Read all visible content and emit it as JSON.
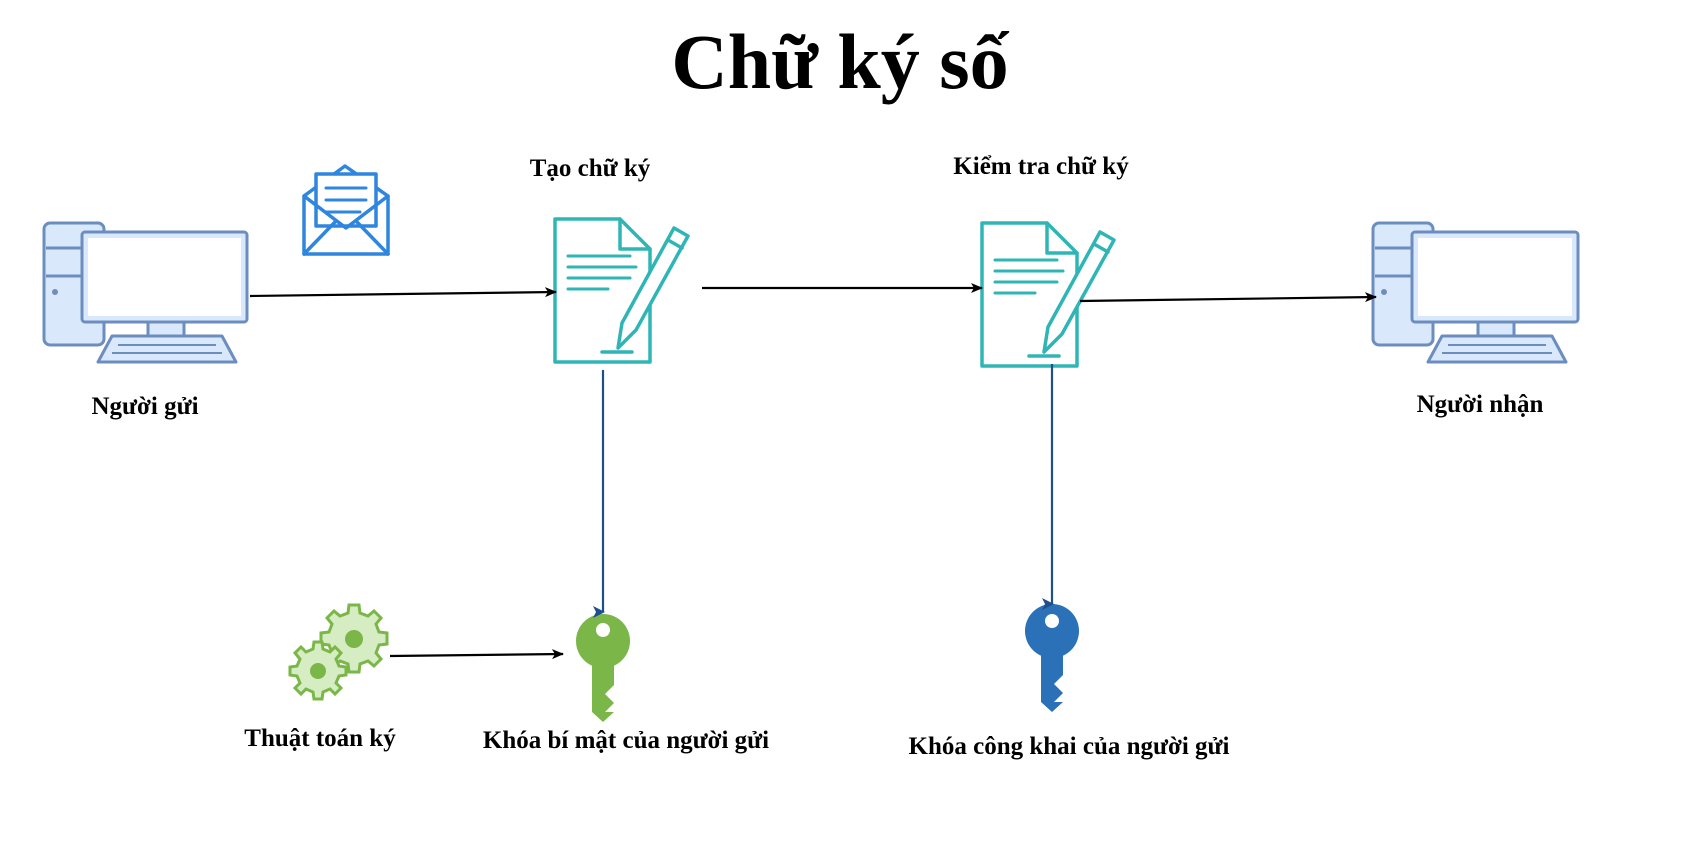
{
  "title": "Chữ ký số",
  "nodes": {
    "sender": {
      "label": "Người gửi",
      "icon": "computer-icon"
    },
    "receiver": {
      "label": "Người nhận",
      "icon": "computer-icon"
    },
    "create_signature": {
      "label": "Tạo chữ ký",
      "icon": "document-pen-icon"
    },
    "verify_signature": {
      "label": "Kiểm tra chữ ký",
      "icon": "document-pen-icon"
    },
    "message": {
      "icon": "envelope-icon"
    },
    "sign_algorithm": {
      "label": "Thuật toán ký",
      "icon": "gears-icon"
    },
    "private_key": {
      "label": "Khóa bí mật của người gửi",
      "icon": "key-icon"
    },
    "public_key": {
      "label": "Khóa công khai của người gửi",
      "icon": "key-icon"
    }
  },
  "colors": {
    "computer_fill": "#dae8fc",
    "computer_stroke": "#6c8ebf",
    "document": "#2fb5b5",
    "envelope": "#2e86de",
    "private_key": "#7ab648",
    "public_key": "#2a71b8",
    "gears": "#7ab648",
    "flow_arrow": "#000000",
    "key_arrow": "#1f4e8c"
  }
}
